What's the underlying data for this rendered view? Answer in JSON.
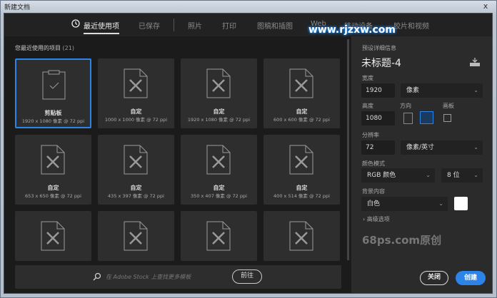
{
  "window": {
    "title": "新建文档",
    "close": "x"
  },
  "tabs": [
    {
      "label": "最近使用项"
    },
    {
      "label": "已保存"
    },
    {
      "label": "照片"
    },
    {
      "label": "打印"
    },
    {
      "label": "图稿和插图"
    },
    {
      "label": "Web"
    },
    {
      "label": "移动设备"
    },
    {
      "label": "胶片和视频"
    }
  ],
  "watermark_top": "www.rjzxw.com",
  "recent": {
    "heading": "您最近使用的项目",
    "count": "(21)",
    "items": [
      {
        "name": "剪贴板",
        "size": "1920 x 1080 像素 @ 72 ppi",
        "icon": "clipboard"
      },
      {
        "name": "自定",
        "size": "1000 x 1000 像素 @ 72 ppi",
        "icon": "custom-doc"
      },
      {
        "name": "自定",
        "size": "1920 x 1080 像素 @ 72 ppi",
        "icon": "custom-doc"
      },
      {
        "name": "自定",
        "size": "600 x 600 像素 @ 72 ppi",
        "icon": "custom-doc"
      },
      {
        "name": "自定",
        "size": "653 x 650 像素 @ 72 ppi",
        "icon": "custom-doc"
      },
      {
        "name": "自定",
        "size": "435 x 397 像素 @ 72 ppi",
        "icon": "custom-doc"
      },
      {
        "name": "自定",
        "size": "350 x 407 像素 @ 72 ppi",
        "icon": "custom-doc"
      },
      {
        "name": "自定",
        "size": "400 x 514 像素 @ 72 ppi",
        "icon": "custom-doc"
      },
      {
        "name": "",
        "size": "",
        "icon": "custom-doc"
      },
      {
        "name": "",
        "size": "",
        "icon": "custom-doc"
      },
      {
        "name": "",
        "size": "",
        "icon": "custom-doc"
      },
      {
        "name": "",
        "size": "",
        "icon": "custom-doc"
      }
    ]
  },
  "search": {
    "placeholder": "在 Adobe Stock 上查找更多模板",
    "go": "前往"
  },
  "preset": {
    "heading": "预设详细信息",
    "title": "未标题-4",
    "width_label": "宽度",
    "width": "1920",
    "width_unit": "像素",
    "height_label": "高度",
    "height": "1080",
    "orientation_label": "方向",
    "artboard_label": "画板",
    "resolution_label": "分辨率",
    "resolution": "72",
    "resolution_unit": "像素/英寸",
    "color_mode_label": "颜色模式",
    "color_mode": "RGB 颜色",
    "bit_depth": "8 位",
    "background_label": "背景内容",
    "background": "白色",
    "background_color": "#ffffff",
    "advanced": "高级选项"
  },
  "watermark_bottom": "68ps.com原创",
  "buttons": {
    "close": "关闭",
    "create": "创建"
  },
  "colors": {
    "accent": "#2c83e8"
  }
}
